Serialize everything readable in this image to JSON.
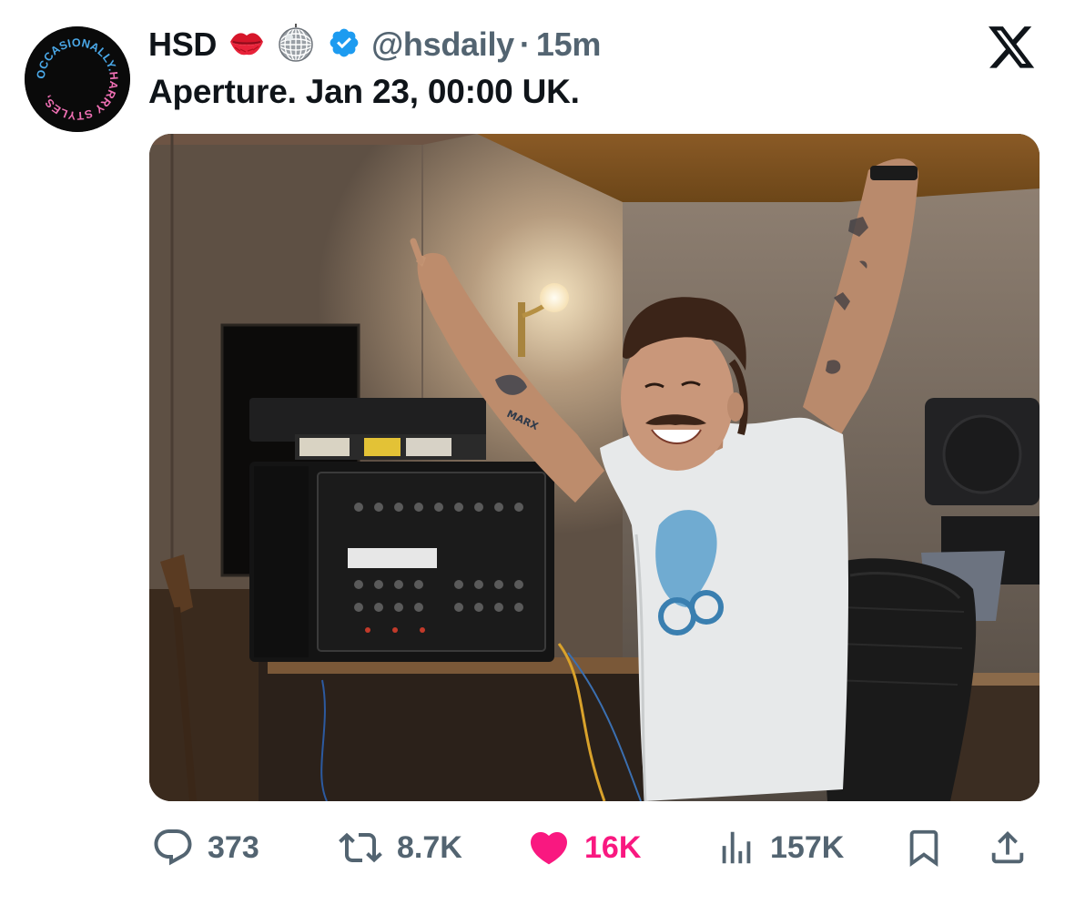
{
  "tweet": {
    "display_name": "HSD",
    "handle": "@hsdaily",
    "separator": "·",
    "time": "15m",
    "text": "Aperture. Jan 23, 00:00 UK.",
    "avatar_text": "OCCASIONALLY.HARRY STYLES,",
    "name_emojis": [
      "lips-emoji",
      "disco-ball-emoji"
    ],
    "verified": true,
    "colors": {
      "text": "#0f1419",
      "secondary": "#536471",
      "verified": "#1d9bf0",
      "like": "#f91880"
    }
  },
  "actions": {
    "replies": "373",
    "reposts": "8.7K",
    "likes": "16K",
    "views": "157K",
    "liked": true
  },
  "icons": {
    "reply": "speech-bubble-icon",
    "repost": "repost-arrows-icon",
    "like": "heart-icon",
    "views": "bar-chart-icon",
    "bookmark": "bookmark-icon",
    "share": "share-upload-icon",
    "platform": "x-logo-icon"
  }
}
